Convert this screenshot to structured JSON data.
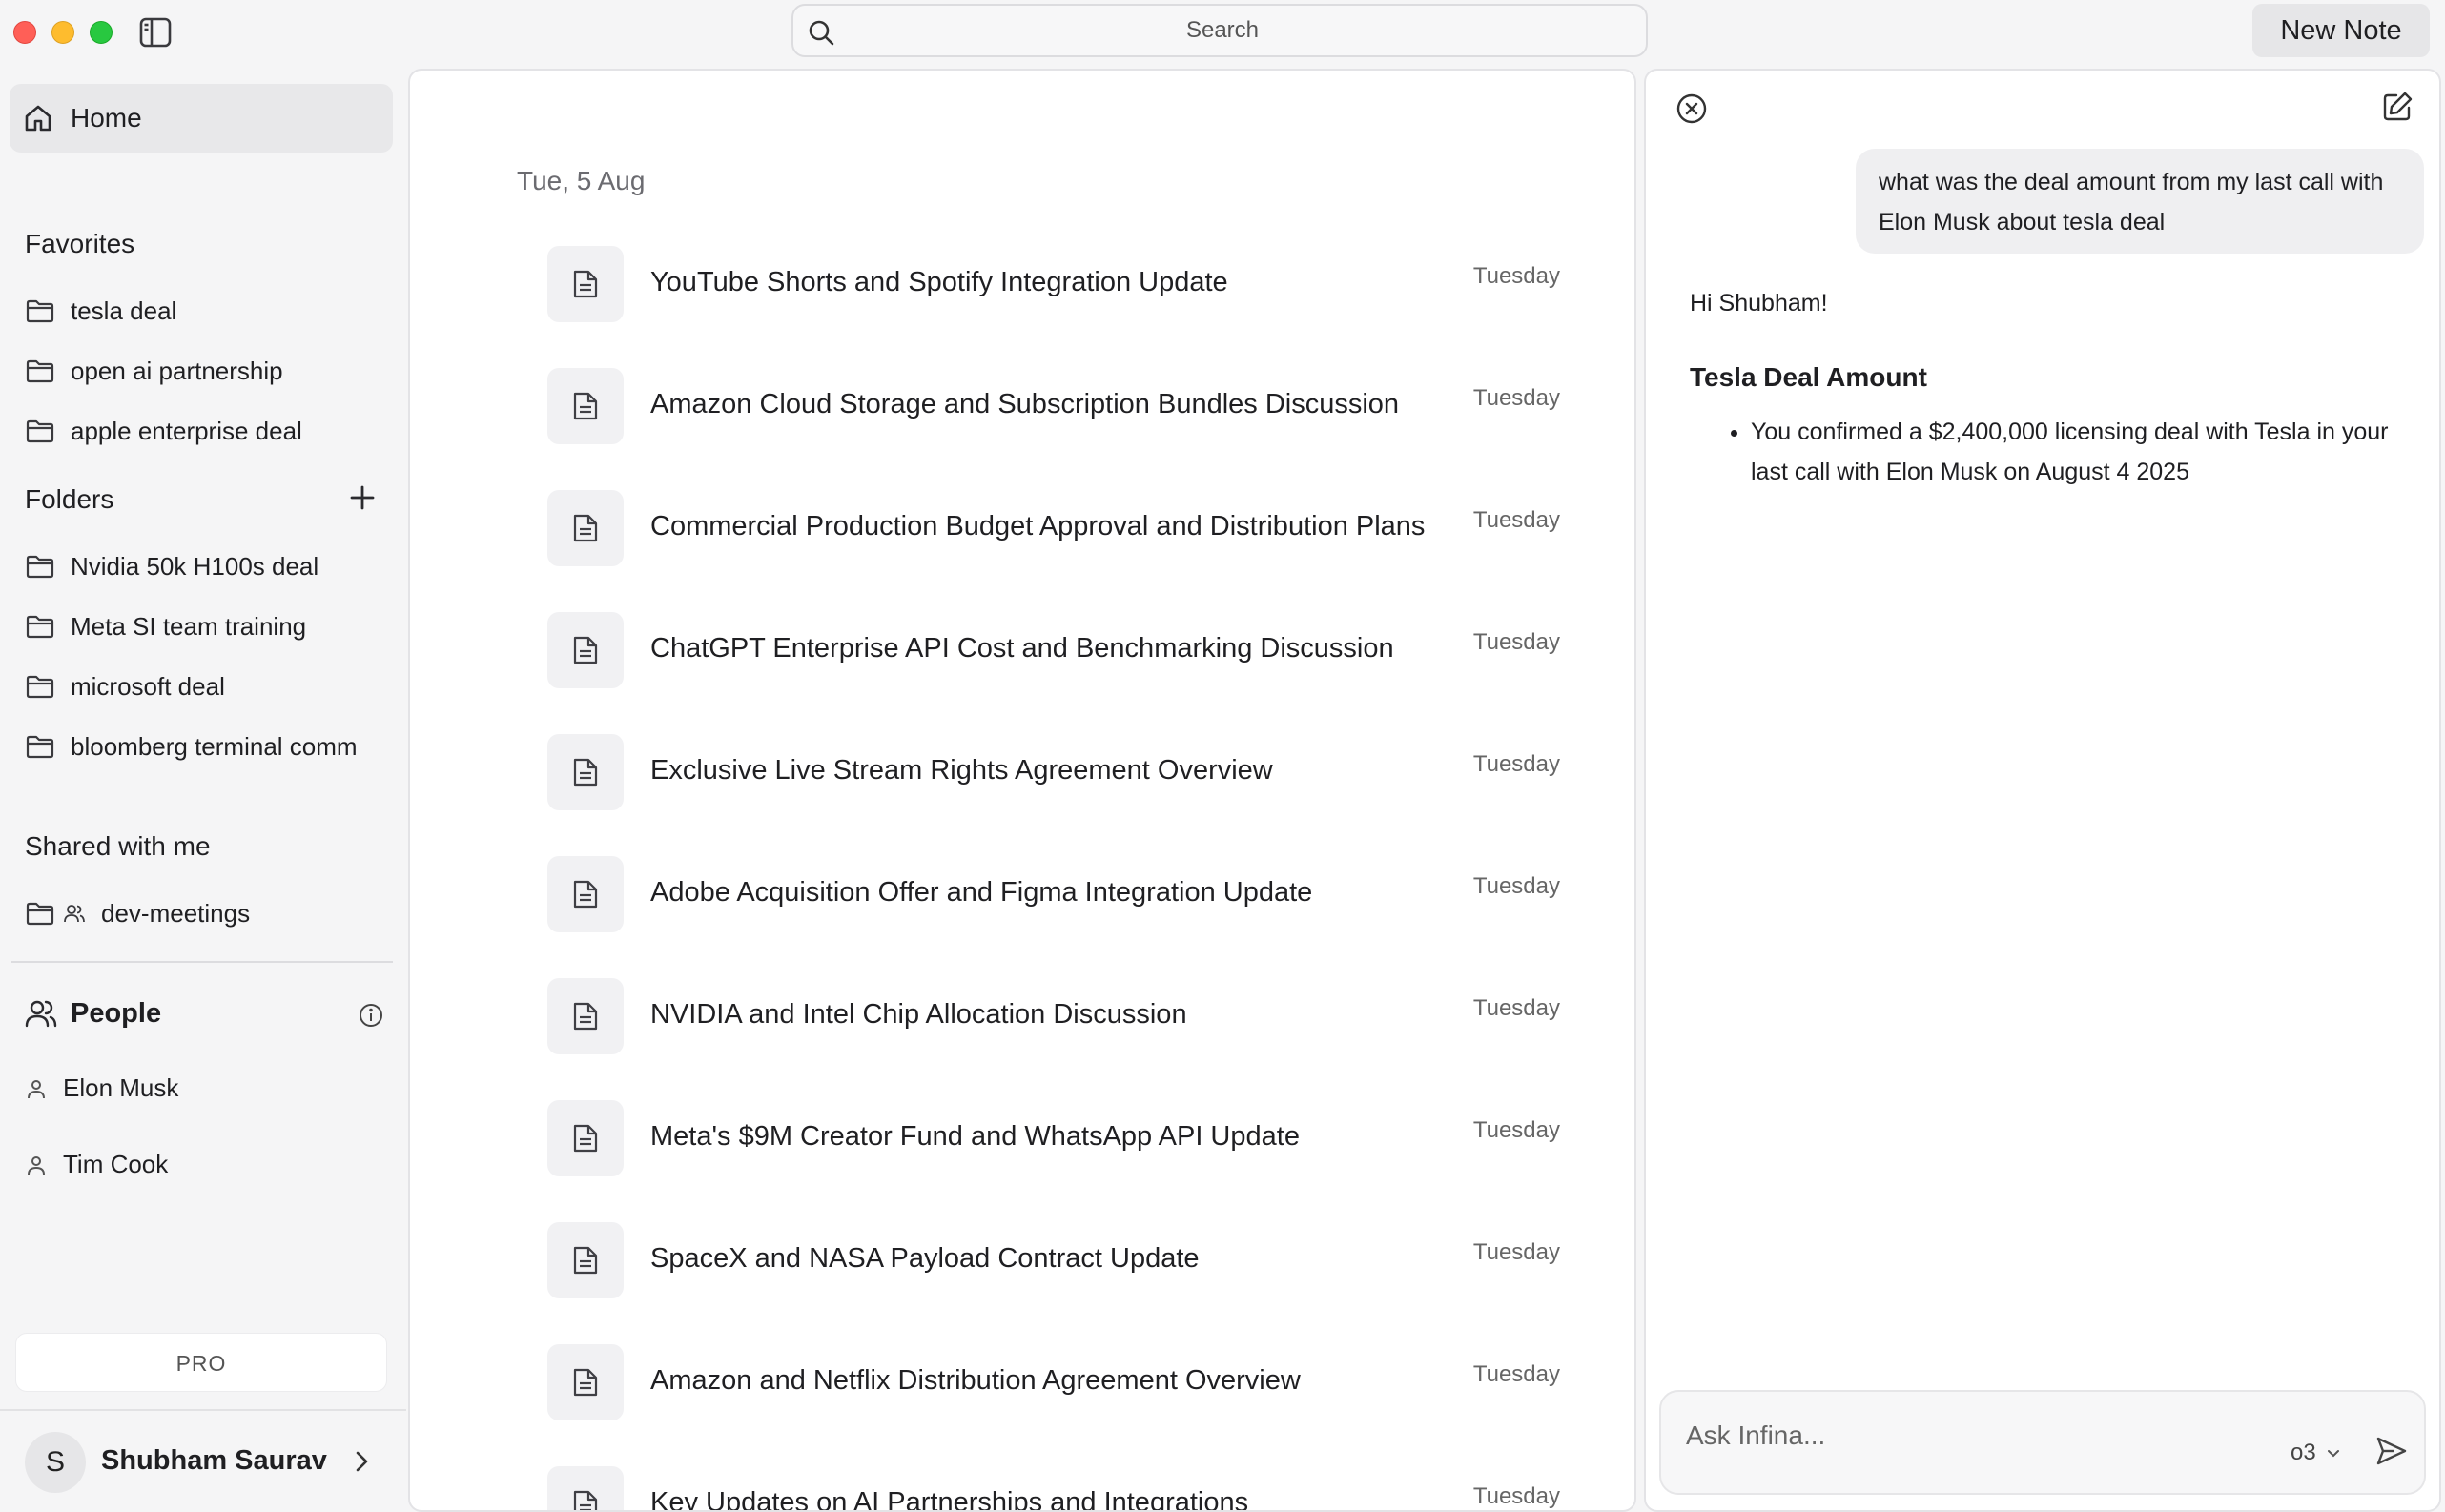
{
  "topbar": {
    "search_placeholder": "Search",
    "new_note_label": "New Note"
  },
  "sidebar": {
    "home_label": "Home",
    "favorites_title": "Favorites",
    "favorites": [
      "tesla deal",
      "open ai partnership",
      "apple enterprise deal"
    ],
    "folders_title": "Folders",
    "folders": [
      "Nvidia 50k H100s deal",
      "Meta SI team training",
      "microsoft deal",
      "bloomberg terminal comm"
    ],
    "shared_title": "Shared with me",
    "shared": [
      "dev-meetings"
    ],
    "people_title": "People",
    "people": [
      "Elon Musk",
      "Tim Cook"
    ],
    "pro_label": "PRO",
    "user": {
      "initial": "S",
      "name": "Shubham Saurav"
    }
  },
  "notes": {
    "date_heading": "Tue, 5 Aug",
    "items": [
      {
        "title": "YouTube Shorts and Spotify Integration Update",
        "day": "Tuesday"
      },
      {
        "title": "Amazon Cloud Storage and Subscription Bundles Discussion",
        "day": "Tuesday"
      },
      {
        "title": "Commercial Production Budget Approval and Distribution Plans",
        "day": "Tuesday"
      },
      {
        "title": "ChatGPT Enterprise API Cost and Benchmarking Discussion",
        "day": "Tuesday"
      },
      {
        "title": "Exclusive Live Stream Rights Agreement Overview",
        "day": "Tuesday"
      },
      {
        "title": "Adobe Acquisition Offer and Figma Integration Update",
        "day": "Tuesday"
      },
      {
        "title": "NVIDIA and Intel Chip Allocation Discussion",
        "day": "Tuesday"
      },
      {
        "title": "Meta's $9M Creator Fund and WhatsApp API Update",
        "day": "Tuesday"
      },
      {
        "title": "SpaceX and NASA Payload Contract Update",
        "day": "Tuesday"
      },
      {
        "title": "Amazon and Netflix Distribution Agreement Overview",
        "day": "Tuesday"
      },
      {
        "title": "Key Updates on AI Partnerships and Integrations",
        "day": "Tuesday"
      }
    ]
  },
  "chat": {
    "user_message": "what was the deal amount from my last call with Elon Musk about tesla deal",
    "greeting": "Hi Shubham!",
    "answer_heading": "Tesla Deal Amount",
    "answer_bullets": [
      "You confirmed a $2,400,000 licensing deal with Tesla in your last call with Elon Musk on August 4 2025"
    ],
    "input_placeholder": "Ask Infina...",
    "model": "o3"
  }
}
